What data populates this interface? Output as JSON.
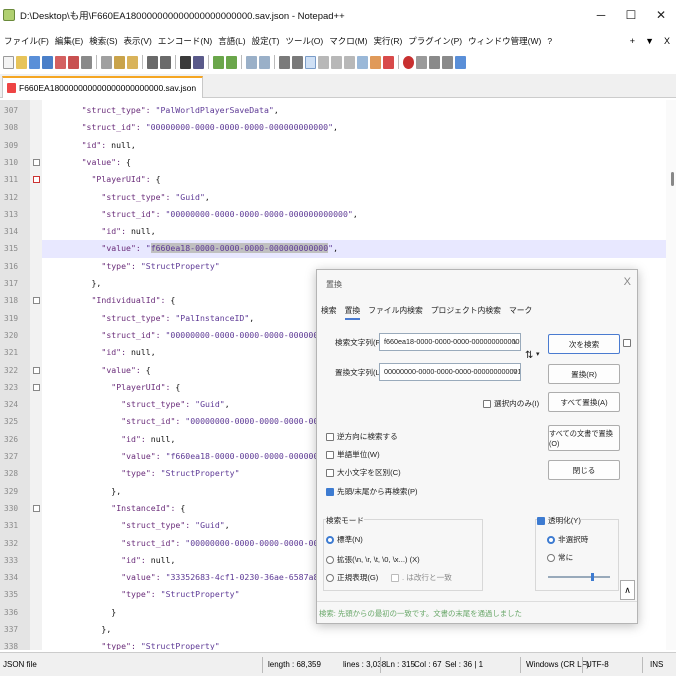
{
  "window": {
    "title": "D:\\Desktop\\も用\\F660EA180000000000000000000000.sav.json - Notepad++",
    "controls": [
      "─",
      "☐",
      "✕"
    ]
  },
  "menubar": {
    "items": [
      "ファイル(F)",
      "編集(E)",
      "検索(S)",
      "表示(V)",
      "エンコード(N)",
      "言語(L)",
      "設定(T)",
      "ツール(O)",
      "マクロ(M)",
      "実行(R)",
      "プラグイン(P)",
      "ウィンドウ管理(W)",
      "?"
    ],
    "right": [
      "+",
      "▼",
      "X"
    ]
  },
  "tab": {
    "label": "F660EA180000000000000000000000.sav.json"
  },
  "editor": {
    "lines": [
      {
        "no": "307",
        "indent": 8,
        "text": "\"struct_type\": \"PalWorldPlayerSaveData\","
      },
      {
        "no": "308",
        "indent": 8,
        "text": "\"struct_id\": \"00000000-0000-0000-0000-000000000000\","
      },
      {
        "no": "309",
        "indent": 8,
        "text": "\"id\": null,"
      },
      {
        "no": "310",
        "indent": 8,
        "text": "\"value\": {"
      },
      {
        "no": "311",
        "indent": 10,
        "text": "\"PlayerUId\": {"
      },
      {
        "no": "312",
        "indent": 12,
        "text": "\"struct_type\": \"Guid\","
      },
      {
        "no": "313",
        "indent": 12,
        "text": "\"struct_id\": \"00000000-0000-0000-0000-000000000000\","
      },
      {
        "no": "314",
        "indent": 12,
        "text": "\"id\": null,"
      },
      {
        "no": "315",
        "indent": 12,
        "text": "\"value\": \"f660ea18-0000-0000-0000-000000000000\","
      },
      {
        "no": "316",
        "indent": 12,
        "text": "\"type\": \"StructProperty\""
      },
      {
        "no": "317",
        "indent": 10,
        "text": "},"
      },
      {
        "no": "318",
        "indent": 10,
        "text": "\"IndividualId\": {"
      },
      {
        "no": "319",
        "indent": 12,
        "text": "\"struct_type\": \"PalInstanceID\","
      },
      {
        "no": "320",
        "indent": 12,
        "text": "\"struct_id\": \"00000000-0000-0000-0000-000000000000\","
      },
      {
        "no": "321",
        "indent": 12,
        "text": "\"id\": null,"
      },
      {
        "no": "322",
        "indent": 12,
        "text": "\"value\": {"
      },
      {
        "no": "323",
        "indent": 14,
        "text": "\"PlayerUId\": {"
      },
      {
        "no": "324",
        "indent": 16,
        "text": "\"struct_type\": \"Guid\","
      },
      {
        "no": "325",
        "indent": 16,
        "text": "\"struct_id\": \"00000000-0000-0000-0000-000000000000\","
      },
      {
        "no": "326",
        "indent": 16,
        "text": "\"id\": null,"
      },
      {
        "no": "327",
        "indent": 16,
        "text": "\"value\": \"f660ea18-0000-0000-0000-000000000000\","
      },
      {
        "no": "328",
        "indent": 16,
        "text": "\"type\": \"StructProperty\""
      },
      {
        "no": "329",
        "indent": 14,
        "text": "},"
      },
      {
        "no": "330",
        "indent": 14,
        "text": "\"InstanceId\": {"
      },
      {
        "no": "331",
        "indent": 16,
        "text": "\"struct_type\": \"Guid\","
      },
      {
        "no": "332",
        "indent": 16,
        "text": "\"struct_id\": \"00000000-0000-0000-0000-000000000000\","
      },
      {
        "no": "333",
        "indent": 16,
        "text": "\"id\": null,"
      },
      {
        "no": "334",
        "indent": 16,
        "text": "\"value\": \"33352683-4cf1-0230-36ae-6587a8a59ac5\","
      },
      {
        "no": "335",
        "indent": 16,
        "text": "\"type\": \"StructProperty\""
      },
      {
        "no": "336",
        "indent": 14,
        "text": "}"
      },
      {
        "no": "337",
        "indent": 12,
        "text": "},"
      },
      {
        "no": "338",
        "indent": 12,
        "text": "\"type\": \"StructProperty\""
      }
    ],
    "current_line": "315",
    "selected_text": "f660ea18-0000-0000-0000-000000000000"
  },
  "dialog": {
    "title": "置換",
    "close": "X",
    "tabs": [
      "検索",
      "置換",
      "ファイル内検索",
      "プロジェクト内検索",
      "マーク"
    ],
    "active_tab": "置換",
    "find_label": "検索文字列(F) :",
    "find_value": "f660ea18-0000-0000-0000-000000000000",
    "replace_label": "置換文字列(L) :",
    "replace_value": "00000000-0000-0000-0000-000000000001",
    "swap_icon": "⇅",
    "in_selection": "選択内のみ(I)",
    "buttons": {
      "find_next": "次を検索",
      "replace": "置換(R)",
      "replace_all": "すべて置換(A)",
      "replace_all_docs": "すべての文書で置換(O)",
      "close": "閉じる"
    },
    "options": [
      {
        "label": "逆方向に検索する",
        "checked": false
      },
      {
        "label": "単語単位(W)",
        "checked": false
      },
      {
        "label": "大小文字を区別(C)",
        "checked": false
      },
      {
        "label": "先頭/末尾から再検索(P)",
        "checked": true
      }
    ],
    "search_mode_title": "検索モード",
    "modes": [
      {
        "label": "標準(N)",
        "checked": true
      },
      {
        "label": "拡張(\\n, \\r, \\t, \\0, \\x...) (X)",
        "checked": false
      },
      {
        "label": "正規表現(G)",
        "checked": false
      }
    ],
    "dot_newline": ". は改行と一致",
    "transparency_label": "透明化(Y)",
    "transparency_modes": [
      {
        "label": "非選択時",
        "checked": true
      },
      {
        "label": "常に",
        "checked": false
      }
    ],
    "transparency_level": 0.7,
    "status": "検索: 先頭からの最初の一致です。文書の末尾を通過しました",
    "collapse": "∧"
  },
  "statusbar": {
    "filetype": "JSON file",
    "length": "length : 68,359",
    "lines": "lines : 3,038",
    "ln": "Ln : 315",
    "col": "Col : 67",
    "sel": "Sel : 36 | 1",
    "eol": "Windows (CR LF)",
    "encoding": "UTF-8",
    "mode": "INS"
  },
  "colors": {
    "key": "#6a2c7a",
    "string": "#5e3a96",
    "current_line": "#e8e8ff",
    "accent": "#3d7bd1",
    "tab_accent": "#f5a623"
  }
}
